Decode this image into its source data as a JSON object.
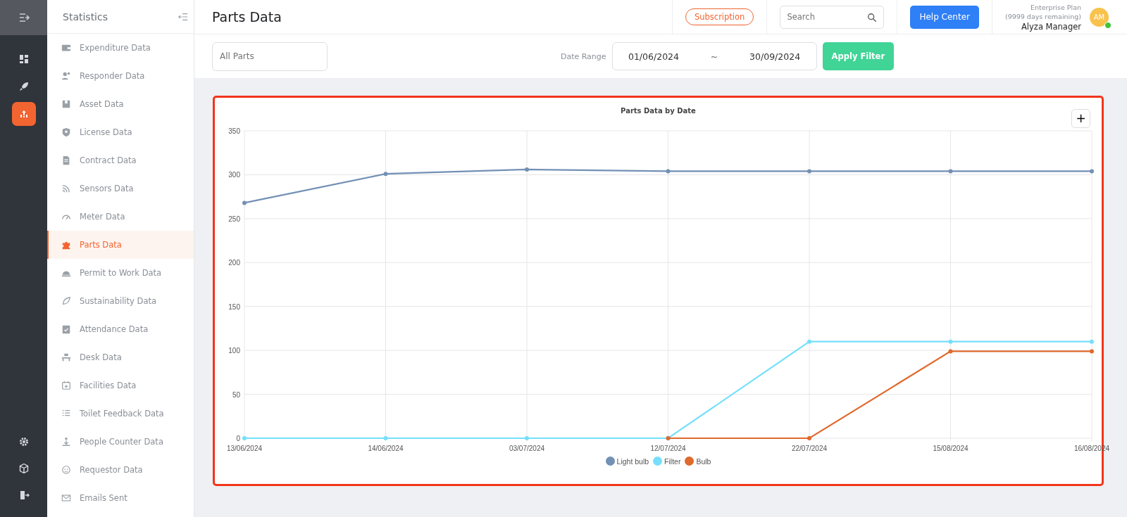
{
  "rail": {
    "items": [
      {
        "selected": false
      },
      {
        "selected": false
      },
      {
        "selected": true
      }
    ]
  },
  "sidebar": {
    "title": "Statistics",
    "items": [
      {
        "label": "Expenditure Data",
        "selected": false
      },
      {
        "label": "Responder Data",
        "selected": false
      },
      {
        "label": "Asset Data",
        "selected": false
      },
      {
        "label": "License Data",
        "selected": false
      },
      {
        "label": "Contract Data",
        "selected": false
      },
      {
        "label": "Sensors Data",
        "selected": false
      },
      {
        "label": "Meter Data",
        "selected": false
      },
      {
        "label": "Parts Data",
        "selected": true
      },
      {
        "label": "Permit to Work Data",
        "selected": false
      },
      {
        "label": "Sustainability Data",
        "selected": false
      },
      {
        "label": "Attendance Data",
        "selected": false
      },
      {
        "label": "Desk Data",
        "selected": false
      },
      {
        "label": "Facilities Data",
        "selected": false
      },
      {
        "label": "Toilet Feedback Data",
        "selected": false
      },
      {
        "label": "People Counter Data",
        "selected": false
      },
      {
        "label": "Requestor Data",
        "selected": false
      },
      {
        "label": "Emails Sent",
        "selected": false
      }
    ]
  },
  "header": {
    "title": "Parts Data",
    "subscription": "Subscription",
    "search": {
      "placeholder": "Search"
    },
    "help": "Help Center",
    "user": {
      "plan": "Enterprise Plan",
      "remaining": "(9999 days remaining)",
      "name": "Alyza Manager",
      "initials": "AM",
      "online": true
    }
  },
  "filters": {
    "parts": {
      "placeholder": "All Parts"
    },
    "date_label": "Date Range",
    "from": "01/06/2024",
    "separator": "~",
    "to": "30/09/2024",
    "apply": "Apply Filter"
  },
  "chart": {
    "expand": "+",
    "chart_data": {
      "type": "line",
      "title": "Parts Data by Date",
      "categories": [
        "13/06/2024",
        "14/06/2024",
        "03/07/2024",
        "12/07/2024",
        "22/07/2024",
        "15/08/2024",
        "16/08/2024"
      ],
      "ylim": [
        0,
        350
      ],
      "yticks": [
        0,
        50,
        100,
        150,
        200,
        250,
        300,
        350
      ],
      "grid": true,
      "series": [
        {
          "name": "Light bulb",
          "color": "#7390b5",
          "marker": true,
          "values": [
            268,
            301,
            306,
            304,
            304,
            304,
            304
          ]
        },
        {
          "name": "Filter",
          "color": "#75dffc",
          "marker": true,
          "values": [
            0,
            0,
            0,
            0,
            110,
            110,
            110
          ]
        },
        {
          "name": "Bulb",
          "color": "#e0692c",
          "marker": true,
          "values": [
            null,
            null,
            null,
            0,
            0,
            99,
            99
          ]
        }
      ]
    }
  }
}
